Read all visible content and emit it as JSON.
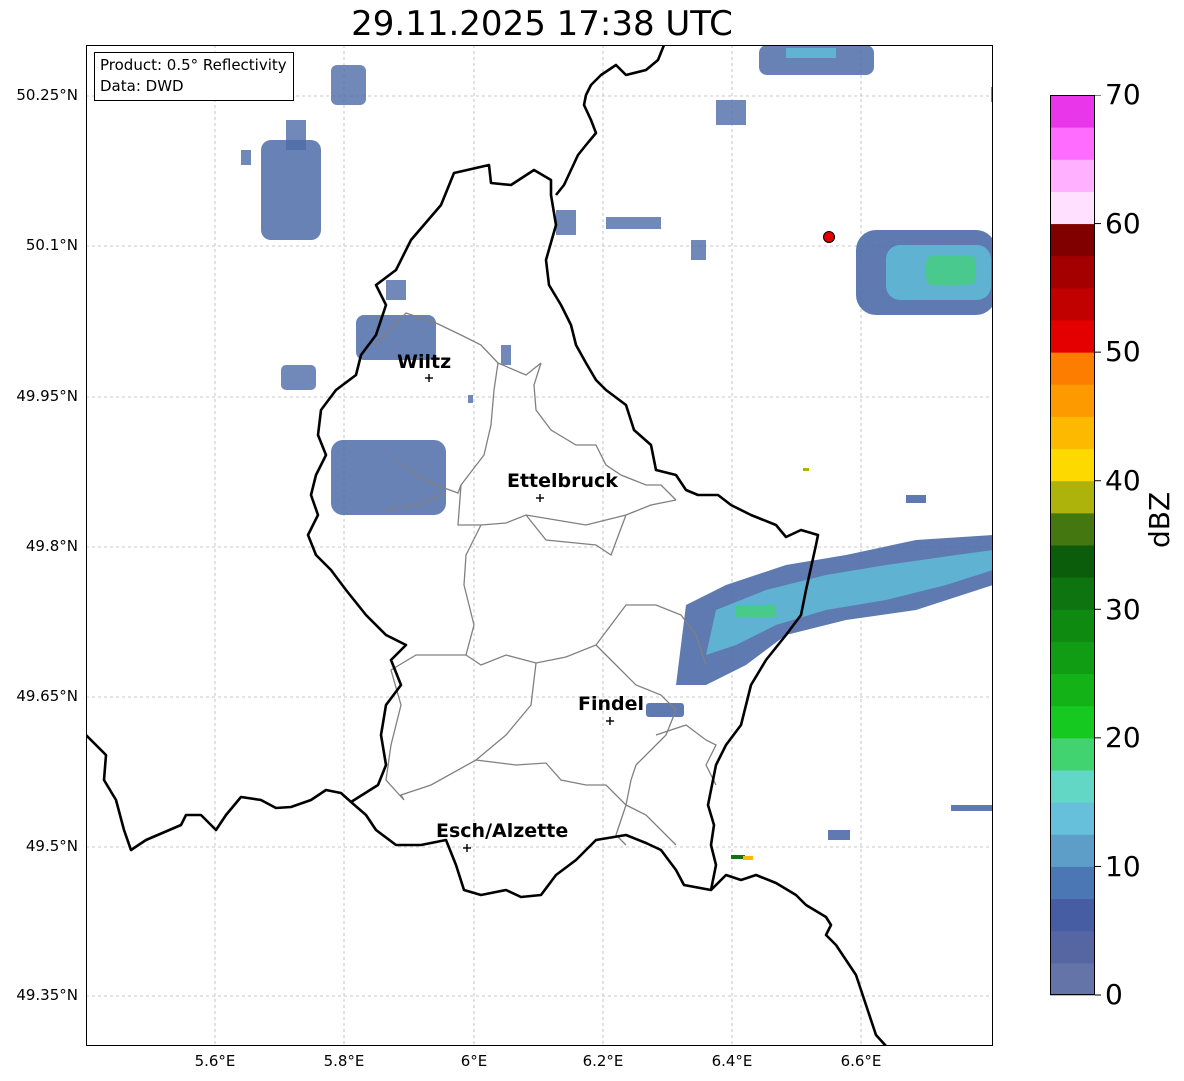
{
  "title": "29.11.2025 17:38 UTC",
  "info": {
    "product": "Product: 0.5° Reflectivity",
    "source": "Data: DWD"
  },
  "lat_ticks": [
    "50.25°N",
    "50.1°N",
    "49.95°N",
    "49.8°N",
    "49.65°N",
    "49.5°N",
    "49.35°N"
  ],
  "lon_ticks": [
    "5.6°E",
    "5.8°E",
    "6°E",
    "6.2°E",
    "6.4°E",
    "6.6°E"
  ],
  "colorbar": {
    "label": "dBZ",
    "ticks": [
      "0",
      "10",
      "20",
      "30",
      "40",
      "50",
      "60",
      "70"
    ],
    "colors": [
      "#6574a8",
      "#5566a2",
      "#475da3",
      "#4b78b4",
      "#5c9ec7",
      "#66c0dc",
      "#62d7c6",
      "#40d370",
      "#16c921",
      "#13b318",
      "#109d13",
      "#0e8a10",
      "#0e7410",
      "#0b5c0b",
      "#457710",
      "#adb30b",
      "#fdd900",
      "#fdb900",
      "#fd9a00",
      "#fd7d00",
      "#e50000",
      "#c10000",
      "#a50000",
      "#800000",
      "#ffe1ff",
      "#ffb1ff",
      "#ff6cff",
      "#ea36ea"
    ]
  },
  "cities": [
    {
      "name": "Wiltz"
    },
    {
      "name": "Ettelbruck"
    },
    {
      "name": "Findel"
    },
    {
      "name": "Esch/Alzette"
    }
  ],
  "colors": {
    "border": "#000000",
    "canton_lines": "#808080",
    "marker": "#e10000",
    "echo_light": "#4d6ca8",
    "echo_mid": "#5fb8d6",
    "echo_strong": "#40d370"
  }
}
